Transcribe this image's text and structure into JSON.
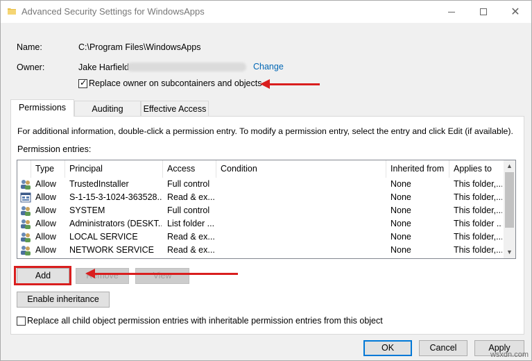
{
  "window": {
    "title": "Advanced Security Settings for WindowsApps"
  },
  "info": {
    "name_label": "Name:",
    "name_value": "C:\\Program Files\\WindowsApps",
    "owner_label": "Owner:",
    "owner_value": "Jake Harfield",
    "change_link": "Change",
    "replace_owner_label": "Replace owner on subcontainers and objects",
    "replace_owner_checked": true
  },
  "tabs": [
    {
      "label": "Permissions",
      "active": true
    },
    {
      "label": "Auditing",
      "active": false
    },
    {
      "label": "Effective Access",
      "active": false
    }
  ],
  "panel": {
    "info_text": "For additional information, double-click a permission entry. To modify a permission entry, select the entry and click Edit (if available).",
    "entries_label": "Permission entries:"
  },
  "table": {
    "columns": [
      "Type",
      "Principal",
      "Access",
      "Condition",
      "Inherited from",
      "Applies to"
    ],
    "rows": [
      {
        "icon": "group-icon",
        "type": "Allow",
        "principal": "TrustedInstaller",
        "access": "Full control",
        "condition": "",
        "inherited": "None",
        "applies": "This folder,..."
      },
      {
        "icon": "app-package-icon",
        "type": "Allow",
        "principal": "S-1-15-3-1024-363528...",
        "access": "Read & ex...",
        "condition": "",
        "inherited": "None",
        "applies": "This folder,..."
      },
      {
        "icon": "group-icon",
        "type": "Allow",
        "principal": "SYSTEM",
        "access": "Full control",
        "condition": "",
        "inherited": "None",
        "applies": "This folder,..."
      },
      {
        "icon": "group-icon",
        "type": "Allow",
        "principal": "Administrators (DESKT...",
        "access": "List folder ...",
        "condition": "",
        "inherited": "None",
        "applies": "This folder ..."
      },
      {
        "icon": "group-icon",
        "type": "Allow",
        "principal": "LOCAL SERVICE",
        "access": "Read & ex...",
        "condition": "",
        "inherited": "None",
        "applies": "This folder,..."
      },
      {
        "icon": "group-icon",
        "type": "Allow",
        "principal": "NETWORK SERVICE",
        "access": "Read & ex...",
        "condition": "",
        "inherited": "None",
        "applies": "This folder,..."
      }
    ]
  },
  "buttons": {
    "add": "Add",
    "remove": "Remove",
    "view": "View",
    "enable_inheritance": "Enable inheritance",
    "ok": "OK",
    "cancel": "Cancel",
    "apply": "Apply"
  },
  "replace_child": {
    "label": "Replace all child object permission entries with inheritable permission entries from this object",
    "checked": false
  },
  "watermark": "wsxdn.com",
  "colors": {
    "annotation_red": "#d91e1e",
    "link_blue": "#0066b4",
    "focus_blue": "#0078d7"
  }
}
